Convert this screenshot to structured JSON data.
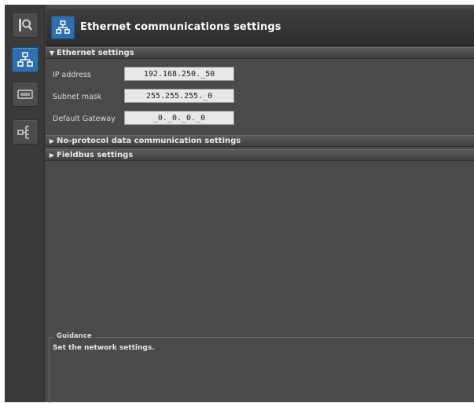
{
  "window": {
    "title": "Ethernet communications settings"
  },
  "sidebar": {
    "items": [
      {
        "icon": "search-list-icon",
        "active": false
      },
      {
        "icon": "network-icon",
        "active": true
      },
      {
        "icon": "display-icon",
        "active": false
      },
      {
        "icon": "fieldbus-icon",
        "active": false
      }
    ]
  },
  "ethernet": {
    "header": "Ethernet settings",
    "expanded": true,
    "fields": {
      "ip": {
        "label": "IP address",
        "value": "192.168.250._50"
      },
      "subnet": {
        "label": "Subnet mask",
        "value": "255.255.255._0"
      },
      "gateway": {
        "label": "Default Gateway",
        "value": "_0._0._0._0"
      }
    }
  },
  "sections": [
    {
      "label": "No-protocol data communication settings",
      "expanded": false
    },
    {
      "label": "Fieldbus settings",
      "expanded": false
    }
  ],
  "guidance": {
    "title": "Guidance",
    "text": "Set the network settings."
  },
  "colors": {
    "accent": "#2d6fb0",
    "panel": "#4a4a4a"
  }
}
